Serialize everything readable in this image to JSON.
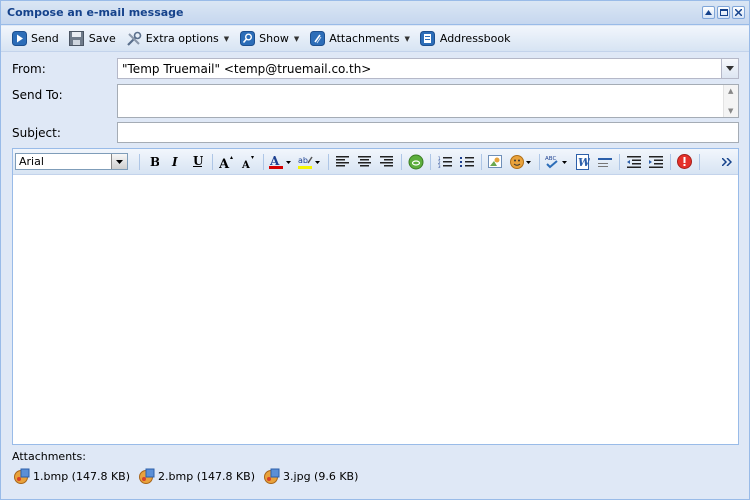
{
  "window": {
    "title": "Compose an e-mail message"
  },
  "toolbar": {
    "send_label": "Send",
    "save_label": "Save",
    "extra_options_label": "Extra options",
    "show_label": "Show",
    "attachments_label": "Attachments",
    "addressbook_label": "Addressbook"
  },
  "form": {
    "from_label": "From:",
    "from_value": "\"Temp Truemail\" <temp@truemail.co.th>",
    "send_to_label": "Send To:",
    "send_to_value": "",
    "subject_label": "Subject:",
    "subject_value": ""
  },
  "editor": {
    "font_family": "Arial",
    "body": ""
  },
  "attachments": {
    "label": "Attachments:",
    "files": [
      {
        "name": "1.bmp (147.8 KB)"
      },
      {
        "name": "2.bmp (147.8 KB)"
      },
      {
        "name": "3.jpg (9.6 KB)"
      }
    ]
  },
  "colors": {
    "title_text": "#15428b",
    "frame_border": "#99bbe8",
    "frame_bg": "#dfe8f6",
    "font_color_bar": "#d40000",
    "highlight_bar": "#f5f500",
    "error_icon": "#e5302a"
  }
}
